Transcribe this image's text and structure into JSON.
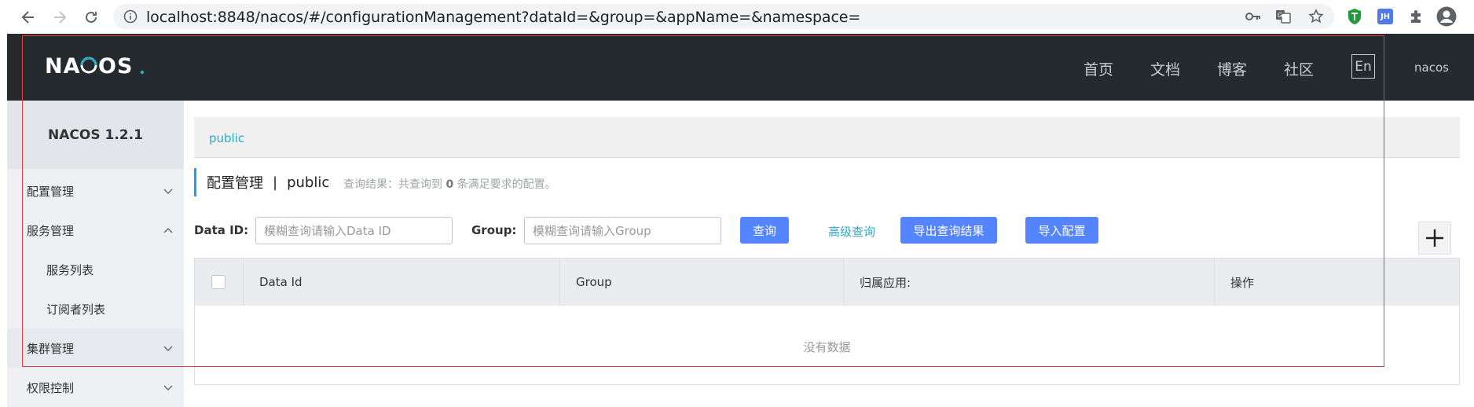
{
  "browser": {
    "url": "localhost:8848/nacos/#/configurationManagement?dataId=&group=&appName=&namespace=",
    "ext_jh": "JH"
  },
  "header": {
    "logo": "NACOS.",
    "nav": [
      "首页",
      "文档",
      "博客",
      "社区"
    ],
    "lang": "En",
    "user": "nacos"
  },
  "sidebar": {
    "title": "NACOS 1.2.1",
    "items": [
      {
        "label": "配置管理"
      },
      {
        "label": "服务管理"
      },
      {
        "label": "服务列表"
      },
      {
        "label": "订阅者列表"
      },
      {
        "label": "集群管理"
      },
      {
        "label": "权限控制"
      }
    ]
  },
  "main": {
    "breadcrumb": "public",
    "title": "配置管理",
    "title_sep": "|",
    "namespace": "public",
    "query_info_prefix": "查询结果：共查询到",
    "query_count": "0",
    "query_info_suffix": "条满足要求的配置。"
  },
  "filters": {
    "dataid_label": "Data ID:",
    "dataid_placeholder": "模糊查询请输入Data ID",
    "group_label": "Group:",
    "group_placeholder": "模糊查询请输入Group",
    "query_btn": "查询",
    "advanced_query": "高级查询",
    "export_btn": "导出查询结果",
    "import_btn": "导入配置"
  },
  "table": {
    "columns": [
      "Data Id",
      "Group",
      "归属应用:",
      "操作"
    ],
    "empty": "没有数据"
  },
  "colors": {
    "header_bg": "#252a2f",
    "primary": "#5584ff",
    "link": "#2eabc6",
    "annotation": "#e34040"
  }
}
